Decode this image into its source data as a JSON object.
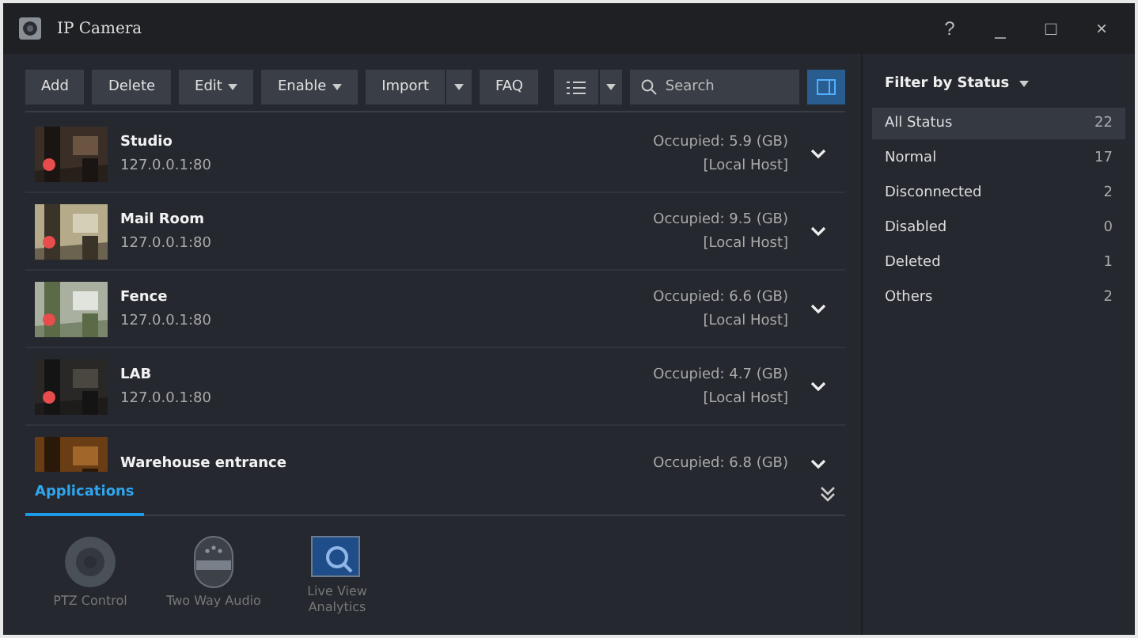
{
  "window": {
    "title": "IP Camera",
    "controls": [
      "?",
      "_",
      "□",
      "×"
    ]
  },
  "toolbar": {
    "buttons": [
      {
        "label": "Add",
        "kind": "plain"
      },
      {
        "label": "Delete",
        "kind": "plain"
      },
      {
        "label": "Edit",
        "kind": "menu"
      },
      {
        "label": "Enable",
        "kind": "menu"
      },
      {
        "label": "Import",
        "kind": "split"
      },
      {
        "label": "FAQ",
        "kind": "plain"
      }
    ],
    "search": {
      "placeholder": "Search"
    }
  },
  "cameras": [
    {
      "name": "Studio",
      "address": "127.0.0.1:80",
      "occupied": "Occupied: 5.9 (GB)",
      "host": "[Local Host]",
      "color": "#e84c4c"
    },
    {
      "name": "Mail Room",
      "address": "127.0.0.1:80",
      "occupied": "Occupied: 9.5 (GB)",
      "host": "[Local Host]",
      "color": "#e84c4c"
    },
    {
      "name": "Fence",
      "address": "127.0.0.1:80",
      "occupied": "Occupied: 6.6 (GB)",
      "host": "[Local Host]",
      "color": "#e84c4c"
    },
    {
      "name": "LAB",
      "address": "127.0.0.1:80",
      "occupied": "Occupied: 4.7 (GB)",
      "host": "[Local Host]",
      "color": "#e84c4c"
    },
    {
      "name": "Warehouse entrance",
      "occupied": "Occupied: 6.8 (GB)"
    }
  ],
  "applications": {
    "tabs": [
      {
        "label": "Applications",
        "selected": true
      }
    ],
    "items": [
      {
        "label": "PTZ Control",
        "kind": "ptz"
      },
      {
        "label": "Two Way Audio",
        "kind": "audio"
      },
      {
        "label": "Live View Analytics",
        "kind": "analytics"
      }
    ]
  },
  "filter": {
    "title": "Filter by Status",
    "items": [
      {
        "label": "All Status",
        "count": "22",
        "selected": true
      },
      {
        "label": "Normal",
        "count": "17",
        "selected": false
      },
      {
        "label": "Disconnected",
        "count": "2",
        "selected": false
      },
      {
        "label": "Disabled",
        "count": "0",
        "selected": false
      },
      {
        "label": "Deleted",
        "count": "1",
        "selected": false
      },
      {
        "label": "Others",
        "count": "2",
        "selected": false
      }
    ]
  }
}
